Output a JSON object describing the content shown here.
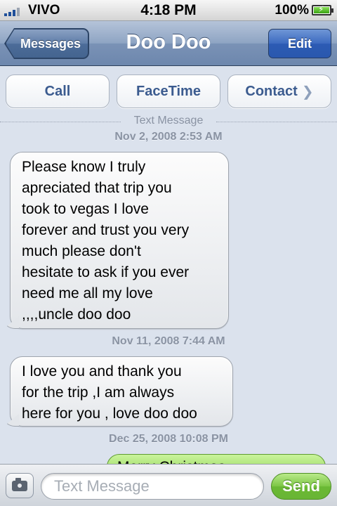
{
  "status_bar": {
    "carrier": "VIVO",
    "time": "4:18 PM",
    "battery_percent": "100%",
    "battery_level": 1.0,
    "signal_bars": 4
  },
  "nav": {
    "back_label": "Messages",
    "title": "Doo Doo",
    "edit_label": "Edit"
  },
  "actions": {
    "call_label": "Call",
    "facetime_label": "FaceTime",
    "contact_label": "Contact"
  },
  "thread": {
    "header_label": "Text Message",
    "messages": [
      {
        "timestamp": "Nov 2, 2008 2:53 AM",
        "lines": [
          "Please know I truly",
          "apreciated that trip you",
          "took to vegas I love",
          "forever and trust you very",
          "much please don't",
          "hesitate to ask if you ever",
          "need me all my love",
          ",,,,uncle doo doo"
        ],
        "direction": "incoming"
      },
      {
        "timestamp": "Nov 11, 2008 7:44 AM",
        "lines": [
          "I love you and thank you",
          "for the trip ,I am always",
          "here for you , love doo doo"
        ],
        "direction": "incoming"
      },
      {
        "timestamp": "Dec 25, 2008 10:08 PM",
        "text": "Merry Christmas",
        "direction": "outgoing"
      }
    ]
  },
  "input_bar": {
    "placeholder": "Text Message",
    "value": "",
    "send_label": "Send",
    "camera_icon": "camera-icon"
  },
  "colors": {
    "nav_blue": "#6d87ad",
    "edit_blue": "#2c5bb4",
    "send_green": "#6ab934",
    "outgoing_bubble": "#8ad14c",
    "incoming_bubble": "#e3e6ea",
    "background": "#dbe2ed"
  }
}
